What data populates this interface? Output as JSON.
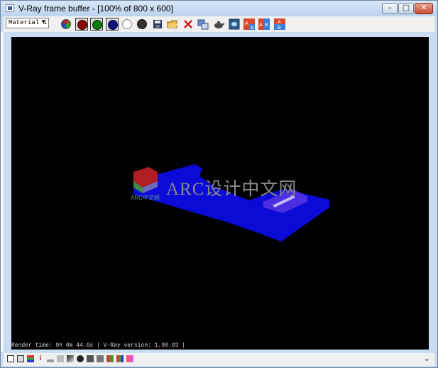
{
  "window": {
    "title": "V-Ray frame buffer - [100% of 800 x 600]"
  },
  "toolbar": {
    "channel_select": "Material 1"
  },
  "render": {
    "watermark_main": "ARC设计中文网",
    "watermark_small": "ARC中文网",
    "status": "Render time:  0h  0m 44.6s | V-Ray version: 1.90.03 |"
  },
  "colors": {
    "background": "#000000",
    "floor": "#0b0ad6",
    "box": "#4b2ee0",
    "cube": "#b11e22"
  }
}
